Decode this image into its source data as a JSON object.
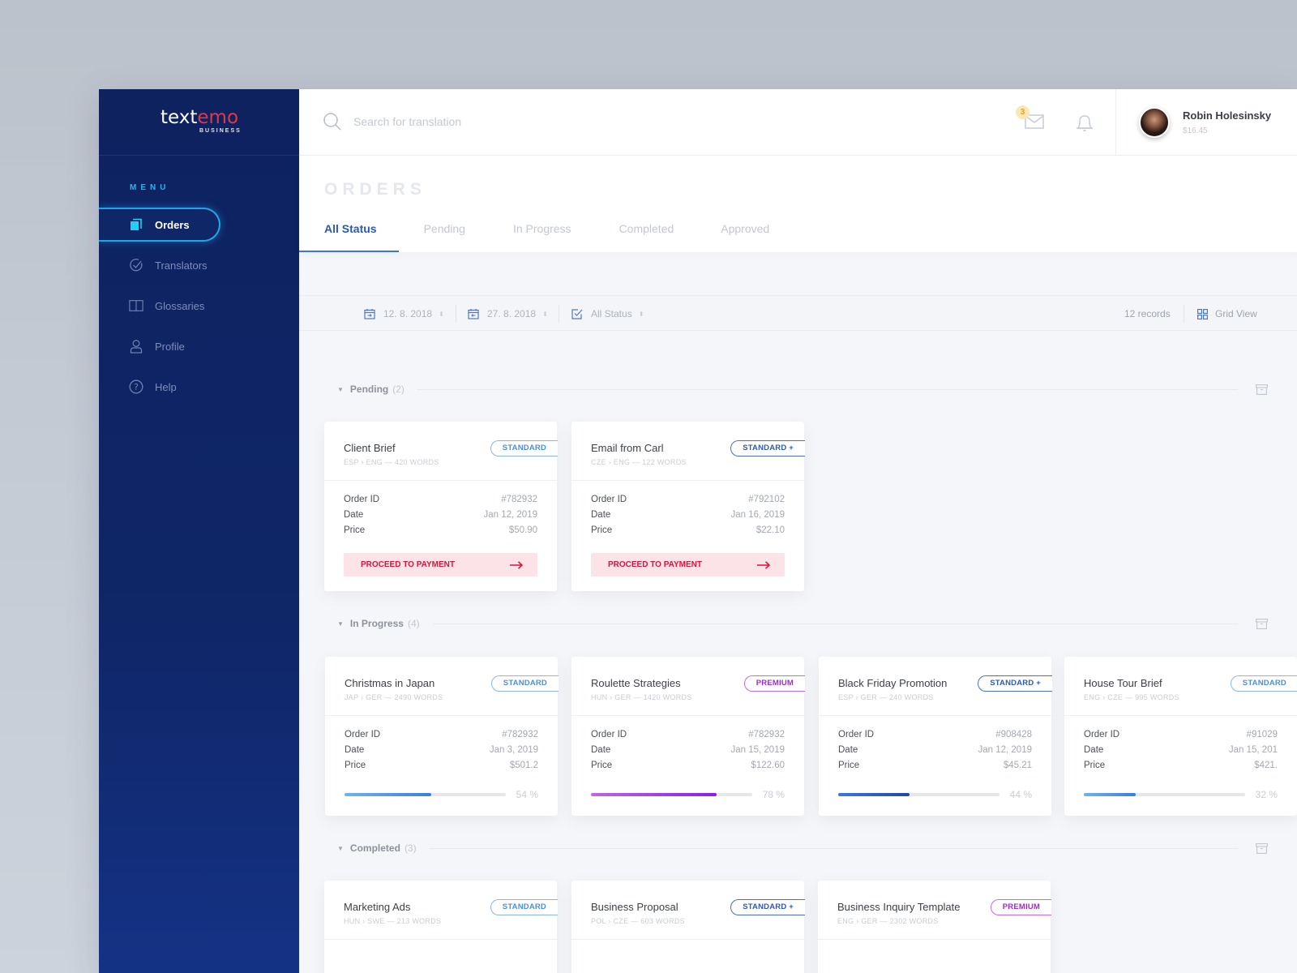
{
  "brand": {
    "logo_white": "text",
    "logo_red": "emo",
    "logo_sub": "BUSINESS"
  },
  "sidebar": {
    "menu_label": "MENU",
    "items": [
      {
        "label": "Orders",
        "icon": "orders-icon",
        "active": true
      },
      {
        "label": "Translators",
        "icon": "check-circle-icon",
        "active": false
      },
      {
        "label": "Glossaries",
        "icon": "book-icon",
        "active": false
      },
      {
        "label": "Profile",
        "icon": "user-icon",
        "active": false
      },
      {
        "label": "Help",
        "icon": "help-icon",
        "active": false
      }
    ]
  },
  "topbar": {
    "search_placeholder": "Search for translation",
    "mail_badge": "3",
    "user": {
      "name": "Robin Holesinsky",
      "balance": "$16.45"
    }
  },
  "page": {
    "title": "ORDERS",
    "tabs": [
      {
        "label": "All Status",
        "active": true
      },
      {
        "label": "Pending",
        "active": false
      },
      {
        "label": "In Progress",
        "active": false
      },
      {
        "label": "Completed",
        "active": false
      },
      {
        "label": "Approved",
        "active": false
      }
    ]
  },
  "filters": {
    "date_from": "12. 8. 2018",
    "date_to": "27. 8. 2018",
    "status": "All Status",
    "records": "12 records",
    "view": "Grid View"
  },
  "labels": {
    "order_id": "Order ID",
    "date": "Date",
    "price": "Price",
    "pay": "PROCEED TO PAYMENT"
  },
  "sections": [
    {
      "name": "Pending",
      "count": "(2)",
      "cards": [
        {
          "title": "Client Brief",
          "meta": "ESP › ENG  —  420 WORDS",
          "badge": "STANDARD",
          "badge_type": "standard",
          "order_id": "#782932",
          "date": "Jan 12, 2019",
          "price": "$50.90"
        },
        {
          "title": "Email from Carl",
          "meta": "CZE › ENG  —  122 WORDS",
          "badge": "STANDARD +",
          "badge_type": "standardplus",
          "order_id": "#792102",
          "date": "Jan 16, 2019",
          "price": "$22.10"
        }
      ]
    },
    {
      "name": "In Progress",
      "count": "(4)",
      "cards": [
        {
          "title": "Christmas in Japan",
          "meta": "JAP › GER  —  2490 WORDS",
          "badge": "STANDARD",
          "badge_type": "standard",
          "order_id": "#782932",
          "date": "Jan 3, 2019",
          "price": "$501.2",
          "progress": 54,
          "progress_label": "54 %",
          "bar": "blue"
        },
        {
          "title": "Roulette Strategies",
          "meta": "HUN › GER  —  1420 WORDS",
          "badge": "PREMIUM",
          "badge_type": "premium",
          "order_id": "#782932",
          "date": "Jan 15, 2019",
          "price": "$122.60",
          "progress": 78,
          "progress_label": "78 %",
          "bar": "purple"
        },
        {
          "title": "Black Friday Promotion",
          "meta": "ESP › GER  —  240 WORDS",
          "badge": "STANDARD +",
          "badge_type": "standardplus",
          "order_id": "#908428",
          "date": "Jan 12, 2019",
          "price": "$45.21",
          "progress": 44,
          "progress_label": "44  %",
          "bar": "navy"
        },
        {
          "title": "House Tour Brief",
          "meta": "ENG › CZE  —  995 WORDS",
          "badge": "STANDARD",
          "badge_type": "standard",
          "order_id": "#91029",
          "date": "Jan 15, 201",
          "price": "$421.",
          "progress": 32,
          "progress_label": "32 %",
          "bar": "blue"
        }
      ]
    },
    {
      "name": "Completed",
      "count": "(3)",
      "cards": [
        {
          "title": "Marketing Ads",
          "meta": "HUN › SWE  —  213 WORDS",
          "badge": "STANDARD",
          "badge_type": "standard"
        },
        {
          "title": "Business Proposal",
          "meta": "POL › CZE  —  603 WORDS",
          "badge": "STANDARD +",
          "badge_type": "standardplus"
        },
        {
          "title": "Business Inquiry Template",
          "meta": "ENG › GER  —  2302 WORDS",
          "badge": "PREMIUM",
          "badge_type": "premium"
        }
      ]
    }
  ]
}
